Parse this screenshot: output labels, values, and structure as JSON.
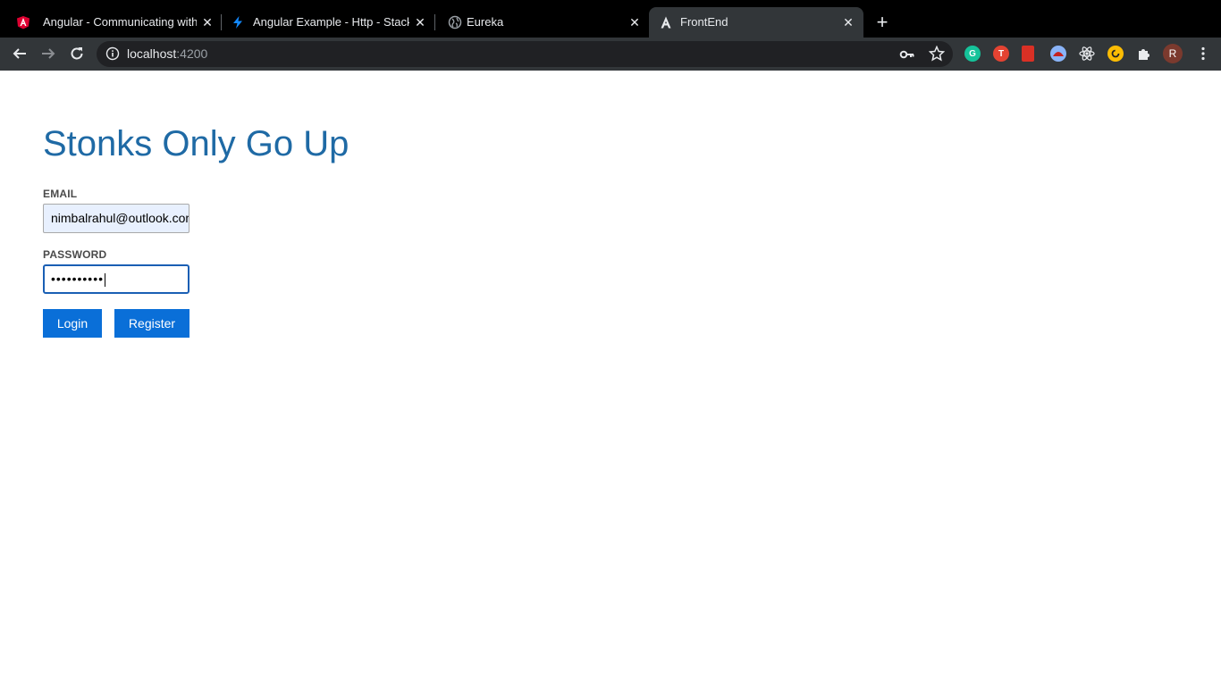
{
  "browser": {
    "tabs": [
      {
        "title": "Angular - Communicating with",
        "favicon": "angular-red-icon",
        "active": false
      },
      {
        "title": "Angular Example - Http - Stack",
        "favicon": "stackblitz-bolt-icon",
        "active": false
      },
      {
        "title": "Eureka",
        "favicon": "globe-icon",
        "active": false
      },
      {
        "title": "FrontEnd",
        "favicon": "angular-icon",
        "active": true
      }
    ],
    "new_tab_label": "+",
    "close_glyph": "✕",
    "address": {
      "host": "localhost",
      "port": ":4200"
    },
    "profile_initial": "R",
    "extensions": [
      "grammarly-icon",
      "todoist-icon",
      "bookmark-red-icon",
      "hat-icon",
      "react-devtools-icon",
      "google-keep-icon",
      "extensions-puzzle-icon"
    ]
  },
  "page": {
    "title": "Stonks Only Go Up",
    "email": {
      "label": "EMAIL",
      "value": "nimbalrahul@outlook.com"
    },
    "password": {
      "label": "PASSWORD",
      "masked_value": "••••••••••"
    },
    "buttons": {
      "login": "Login",
      "register": "Register"
    }
  },
  "colors": {
    "title": "#1f6aa5",
    "button": "#0a6fd8",
    "focus_border": "#1a5fb4",
    "autofill_bg": "#e8f0fe"
  }
}
